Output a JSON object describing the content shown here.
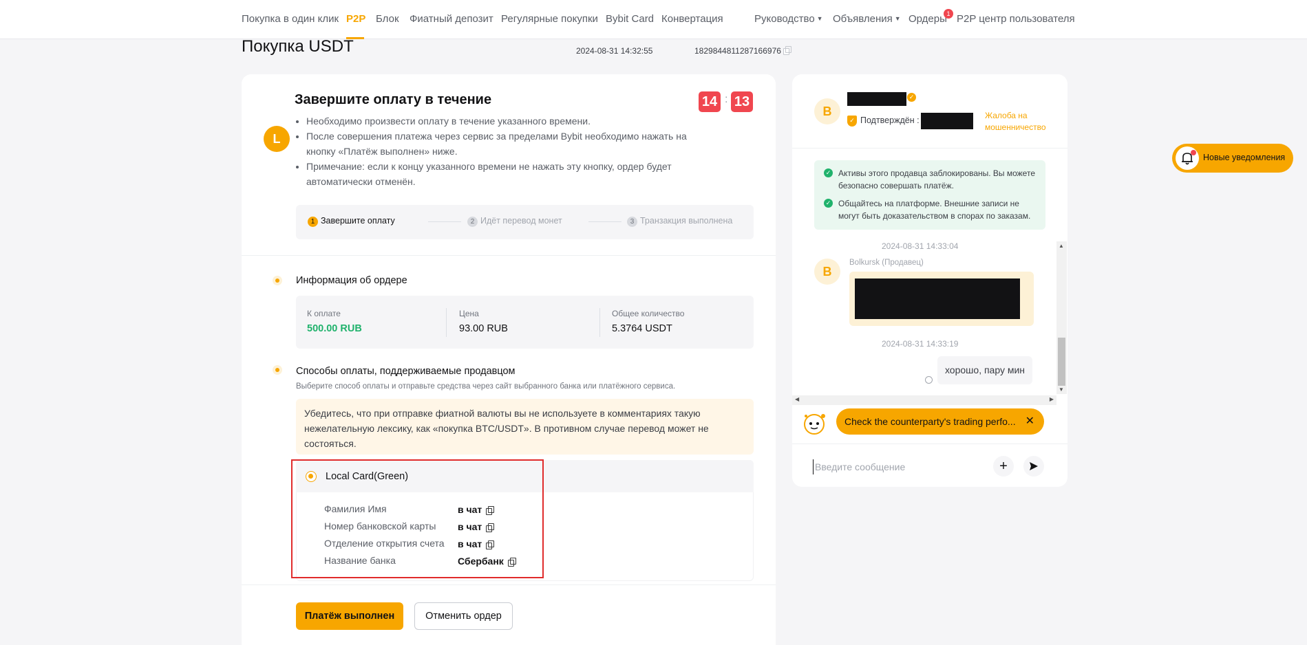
{
  "nav": {
    "items": [
      "Покупка в один клик",
      "P2P",
      "Блок",
      "Фиатный депозит",
      "Регулярные покупки",
      "Bybit Card",
      "Конвертация"
    ],
    "right_items": [
      "Руководство",
      "Объявления",
      "Ордеры",
      "P2P центр пользователя"
    ],
    "orders_badge": "1",
    "active": "P2P"
  },
  "page": {
    "title": "Покупка USDT",
    "datetime": "2024-08-31 14:32:55",
    "order_id": "1829844811287166976"
  },
  "payment": {
    "avatar_letter": "L",
    "title": "Завершите оплату в течение",
    "bullets": [
      "Необходимо произвести оплату в течение указанного времени.",
      "После совершения платежа через сервис за пределами Bybit необходимо нажать на кнопку «Платёж выполнен» ниже.",
      "Примечание: если к концу указанного времени не нажать эту кнопку, ордер будет автоматически отменён."
    ],
    "timer_min": "14",
    "timer_sep": ":",
    "timer_sec": "13"
  },
  "steps": [
    {
      "num": "1",
      "label": "Завершите оплату"
    },
    {
      "num": "2",
      "label": "Идёт перевод монет"
    },
    {
      "num": "3",
      "label": "Транзакция выполнена"
    }
  ],
  "order_info": {
    "title": "Информация об ордере",
    "cols": [
      {
        "label": "К оплате",
        "value": "500.00 RUB"
      },
      {
        "label": "Цена",
        "value": "93.00 RUB"
      },
      {
        "label": "Общее количество",
        "value": "5.3764 USDT"
      }
    ]
  },
  "payment_methods": {
    "title": "Способы оплаты, поддерживаемые продавцом",
    "subtitle": "Выберите способ оплаты и отправьте средства через сайт выбранного банка или платёжного сервиса.",
    "warning": "Убедитесь, что при отправке фиатной валюты вы не используете в комментариях такую нежелательную лексику, как «покупка BTC/USDT». В противном случае перевод может не состояться.",
    "method_name": "Local Card(Green)",
    "rows": [
      {
        "label": "Фамилия Имя",
        "value": "в чат"
      },
      {
        "label": "Номер банковской карты",
        "value": "в чат"
      },
      {
        "label": "Отделение открытия счета",
        "value": "в чат"
      },
      {
        "label": "Название банка",
        "value": "Сбербанк"
      }
    ]
  },
  "buttons": {
    "paid": "Платёж выполнен",
    "cancel": "Отменить ордер"
  },
  "seller": {
    "avatar_letter": "B",
    "confirmed_label": "Подтверждён :",
    "complaint": "Жалоба на мошенничество"
  },
  "chat": {
    "safety": [
      "Активы этого продавца заблокированы. Вы можете безопасно совершать платёж.",
      "Общайтесь на платформе. Внешние записи не могут быть доказательством в спорах по заказам."
    ],
    "time1": "2024-08-31 14:33:04",
    "seller_label": "Bolkursk (Продавец)",
    "time2": "2024-08-31 14:33:19",
    "my_message": "хорошо, пару мин",
    "counterparty_tip": "Check the counterparty's trading perfo...",
    "input_placeholder": "Введите сообщение"
  },
  "notification": {
    "label": "Новые уведомления"
  },
  "colors": {
    "accent": "#f7a600",
    "success": "#20b26c",
    "danger": "#f0464f"
  }
}
